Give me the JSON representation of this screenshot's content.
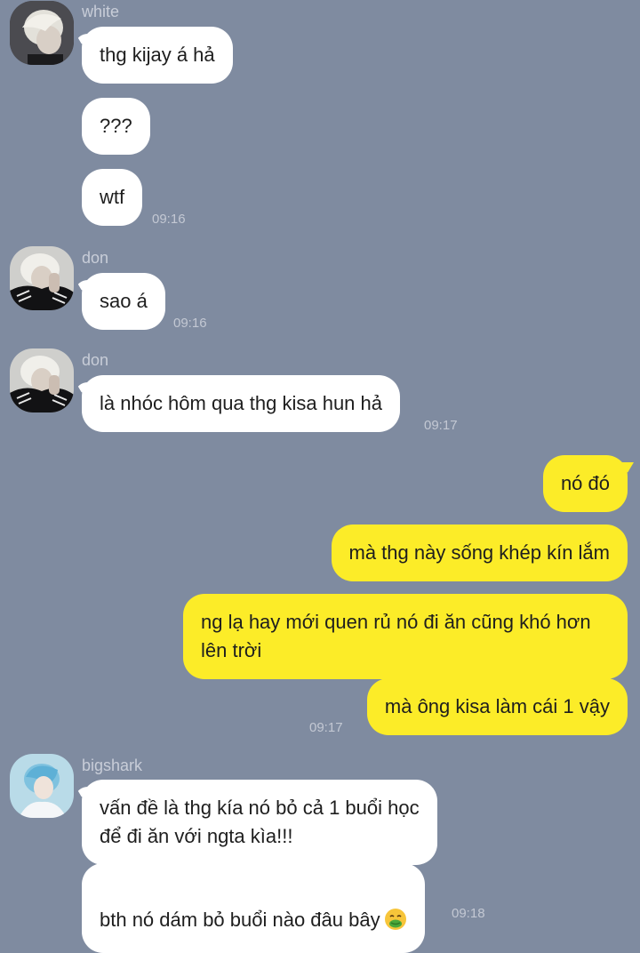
{
  "messages": {
    "m1": {
      "sender": "white",
      "text": "thg kijay á hả"
    },
    "m2": {
      "text": "???"
    },
    "m3": {
      "text": "wtf",
      "time": "09:16"
    },
    "m4": {
      "sender": "don",
      "text": "sao á",
      "time": "09:16"
    },
    "m5": {
      "sender": "don",
      "text": "là nhóc hôm qua thg kisa hun hả",
      "time": "09:17"
    },
    "m6": {
      "text": "nó đó"
    },
    "m7": {
      "text": "mà thg này sống khép kín lắm"
    },
    "m8": {
      "text": "ng lạ hay mới quen rủ nó đi ăn cũng khó hơn\nlên trời"
    },
    "m9": {
      "text": "mà ông kisa làm cái 1 vậy",
      "time": "09:17"
    },
    "m10": {
      "sender": "bigshark",
      "text": "vấn đề là thg kía nó bỏ cả 1 buổi học\nđể đi ăn với ngta kìa!!!"
    },
    "m11": {
      "text": "bth nó dám bỏ buổi nào đâu bây",
      "emoji": "nauseated-face-emoji",
      "time": "09:18"
    }
  },
  "colors": {
    "background": "#7f8ba0",
    "incoming_bubble": "#ffffff",
    "outgoing_bubble": "#fcec28",
    "name_text": "#c8cdd8",
    "time_text": "#c3c8d3"
  }
}
